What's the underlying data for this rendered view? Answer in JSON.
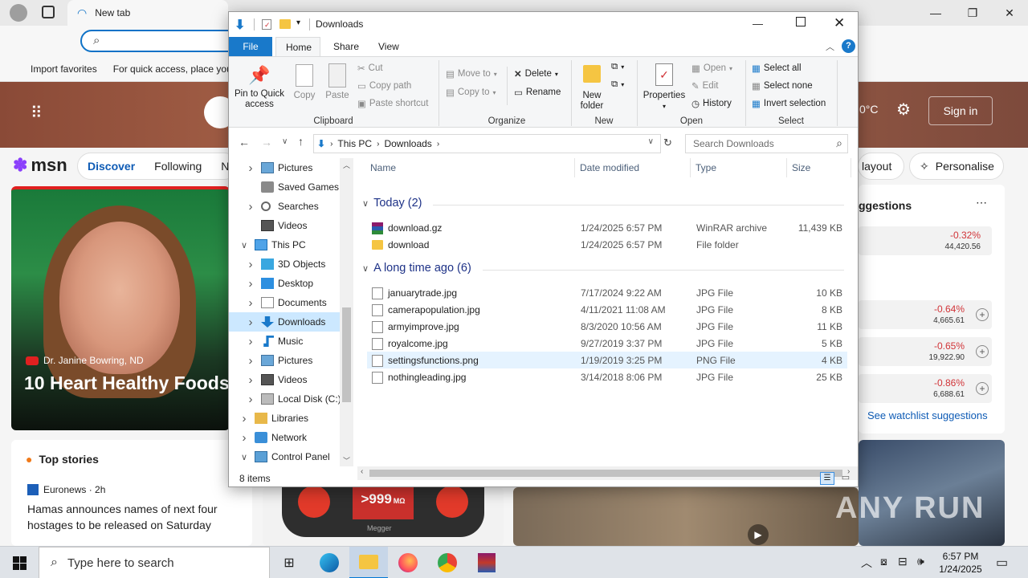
{
  "browser": {
    "tab_title": "New tab",
    "favorites": [
      "Import favorites",
      "For quick access, place you"
    ],
    "sign_in": "Sign in",
    "temperature": "0°C"
  },
  "msn": {
    "logo": "msn",
    "nav": [
      "Discover",
      "Following",
      "N"
    ],
    "layout_btn": "layout",
    "personalise_btn": "Personalise",
    "hero_source": "Dr. Janine Bowring, ND",
    "hero_title": "10 Heart Healthy Foods",
    "top_stories": "Top stories",
    "story_source": "Euronews · 2h",
    "story_title": "Hamas announces names of next four hostages to be released on Saturday",
    "suggestions_title": "ggestions",
    "stocks": [
      {
        "change": "-0.32%",
        "value": "44,420.56"
      },
      {
        "change": "-0.64%",
        "value": "4,665.61"
      },
      {
        "change": "-0.65%",
        "value": "19,922.90"
      },
      {
        "change": "-0.86%",
        "value": "6,688.61"
      }
    ],
    "watchlist_link": "See watchlist suggestions",
    "meter_reading": ">999",
    "meter_unit": "MΩ",
    "meter_brand": "Megger",
    "watermark": "ANY RUN"
  },
  "explorer": {
    "title": "Downloads",
    "tabs": [
      "File",
      "Home",
      "Share",
      "View"
    ],
    "ribbon": {
      "pin": "Pin to Quick access",
      "copy": "Copy",
      "paste": "Paste",
      "cut": "Cut",
      "copy_path": "Copy path",
      "paste_shortcut": "Paste shortcut",
      "clipboard": "Clipboard",
      "move_to": "Move to",
      "copy_to": "Copy to",
      "delete": "Delete",
      "rename": "Rename",
      "organize": "Organize",
      "new_folder": "New folder",
      "new": "New",
      "properties": "Properties",
      "open": "Open",
      "edit": "Edit",
      "history": "History",
      "open_group": "Open",
      "select_all": "Select all",
      "select_none": "Select none",
      "invert_selection": "Invert selection",
      "select": "Select"
    },
    "address": [
      "This PC",
      "Downloads"
    ],
    "search_placeholder": "Search Downloads",
    "tree": [
      {
        "label": "Pictures",
        "chevron": "right",
        "indent": 2,
        "icon": "pictures"
      },
      {
        "label": "Saved Games",
        "chevron": "",
        "indent": 2,
        "icon": "saved-games"
      },
      {
        "label": "Searches",
        "chevron": "right",
        "indent": 2,
        "icon": "searches"
      },
      {
        "label": "Videos",
        "chevron": "",
        "indent": 2,
        "icon": "videos"
      },
      {
        "label": "This PC",
        "chevron": "down",
        "indent": 1,
        "icon": "this-pc"
      },
      {
        "label": "3D Objects",
        "chevron": "right",
        "indent": 2,
        "icon": "3d-objects"
      },
      {
        "label": "Desktop",
        "chevron": "right",
        "indent": 2,
        "icon": "desktop"
      },
      {
        "label": "Documents",
        "chevron": "right",
        "indent": 2,
        "icon": "documents"
      },
      {
        "label": "Downloads",
        "chevron": "right",
        "indent": 2,
        "icon": "downloads",
        "selected": true
      },
      {
        "label": "Music",
        "chevron": "right",
        "indent": 2,
        "icon": "music"
      },
      {
        "label": "Pictures",
        "chevron": "right",
        "indent": 2,
        "icon": "pictures"
      },
      {
        "label": "Videos",
        "chevron": "right",
        "indent": 2,
        "icon": "videos"
      },
      {
        "label": "Local Disk (C:)",
        "chevron": "right",
        "indent": 2,
        "icon": "local-disk"
      },
      {
        "label": "Libraries",
        "chevron": "right",
        "indent": 1,
        "icon": "libraries"
      },
      {
        "label": "Network",
        "chevron": "right",
        "indent": 1,
        "icon": "network"
      },
      {
        "label": "Control Panel",
        "chevron": "down",
        "indent": 1,
        "icon": "control-panel"
      }
    ],
    "columns": [
      "Name",
      "Date modified",
      "Type",
      "Size"
    ],
    "groups": [
      {
        "label": "Today (2)",
        "files": [
          {
            "name": "download.gz",
            "date": "1/24/2025 6:57 PM",
            "type": "WinRAR archive",
            "size": "11,439 KB",
            "icon": "winrar"
          },
          {
            "name": "download",
            "date": "1/24/2025 6:57 PM",
            "type": "File folder",
            "size": "",
            "icon": "folder"
          }
        ]
      },
      {
        "label": "A long time ago (6)",
        "files": [
          {
            "name": "januarytrade.jpg",
            "date": "7/17/2024 9:22 AM",
            "type": "JPG File",
            "size": "10 KB",
            "icon": "image-file"
          },
          {
            "name": "camerapopulation.jpg",
            "date": "4/11/2021 11:08 AM",
            "type": "JPG File",
            "size": "8 KB",
            "icon": "image-file"
          },
          {
            "name": "armyimprove.jpg",
            "date": "8/3/2020 10:56 AM",
            "type": "JPG File",
            "size": "11 KB",
            "icon": "image-file"
          },
          {
            "name": "royalcome.jpg",
            "date": "9/27/2019 3:37 PM",
            "type": "JPG File",
            "size": "5 KB",
            "icon": "image-file"
          },
          {
            "name": "settingsfunctions.png",
            "date": "1/19/2019 3:25 PM",
            "type": "PNG File",
            "size": "4 KB",
            "icon": "image-file",
            "highlighted": true
          },
          {
            "name": "nothingleading.jpg",
            "date": "3/14/2018 8:06 PM",
            "type": "JPG File",
            "size": "25 KB",
            "icon": "image-file"
          }
        ]
      }
    ],
    "status": "8 items"
  },
  "taskbar": {
    "search_placeholder": "Type here to search",
    "time": "6:57 PM",
    "date": "1/24/2025"
  },
  "colors": {
    "accent": "#0078d4",
    "file_tab": "#1979ca",
    "selection": "#cce8ff",
    "group_header": "#1e3287",
    "stock_down": "#d13438"
  }
}
